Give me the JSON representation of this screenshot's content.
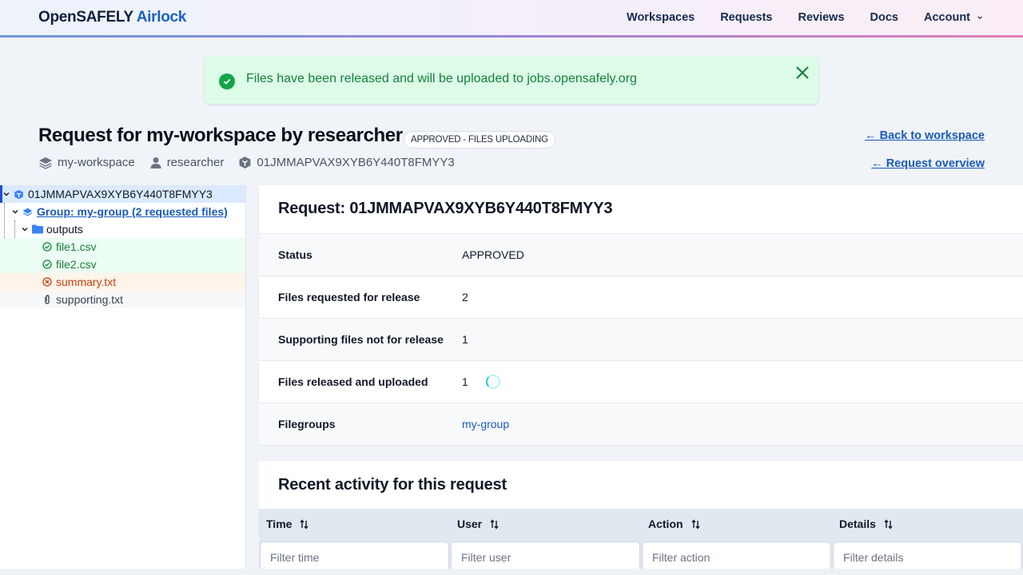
{
  "header": {
    "brand_main": "OpenSAFELY",
    "brand_accent": "Airlock",
    "nav": [
      {
        "label": "Workspaces"
      },
      {
        "label": "Requests"
      },
      {
        "label": "Reviews"
      },
      {
        "label": "Docs"
      },
      {
        "label": "Account",
        "icon": "chevron-down-icon"
      }
    ]
  },
  "flash": {
    "message": "Files have been released and will be uploaded to jobs.opensafely.org",
    "icon": "check-circle-icon",
    "close_icon": "close-icon",
    "color": "#15803d"
  },
  "page": {
    "title": "Request for my-workspace by researcher",
    "status_badge": "APPROVED - FILES UPLOADING",
    "meta": {
      "workspace": "my-workspace",
      "user": "researcher",
      "request_id": "01JMMAPVAX9XYB6Y440T8FMYY3"
    },
    "back_to_workspace": "← Back to workspace",
    "request_overview": "← Request overview"
  },
  "tree": {
    "root": {
      "label": "01JMMAPVAX9XYB6Y440T8FMYY3",
      "icon": "request-cube-icon"
    },
    "group": {
      "label": "Group: my-group (2 requested files)",
      "icon": "layers-icon"
    },
    "folder": {
      "label": "outputs",
      "icon": "folder-icon"
    },
    "files": [
      {
        "label": "file1.csv",
        "state": "approved",
        "icon": "check-circle-icon"
      },
      {
        "label": "file2.csv",
        "state": "approved",
        "icon": "check-circle-icon"
      },
      {
        "label": "summary.txt",
        "state": "rejected",
        "icon": "x-circle-icon"
      },
      {
        "label": "supporting.txt",
        "state": "supporting",
        "icon": "paperclip-icon"
      }
    ],
    "colors": {
      "approved": "#15803d",
      "rejected": "#c2410c",
      "supporting": "#374151",
      "link": "#1a5ab8"
    }
  },
  "request": {
    "title": "Request: 01JMMAPVAX9XYB6Y440T8FMYY3",
    "rows": [
      {
        "label": "Status",
        "value": "APPROVED"
      },
      {
        "label": "Files requested for release",
        "value": "2"
      },
      {
        "label": "Supporting files not for release",
        "value": "1"
      },
      {
        "label": "Files released and uploaded",
        "value": "1",
        "spinner": true
      },
      {
        "label": "Filegroups",
        "value": "my-group",
        "link": true
      }
    ]
  },
  "activity": {
    "title": "Recent activity for this request",
    "columns": [
      {
        "label": "Time",
        "filter_placeholder": "Filter time"
      },
      {
        "label": "User",
        "filter_placeholder": "Filter user"
      },
      {
        "label": "Action",
        "filter_placeholder": "Filter action"
      },
      {
        "label": "Details",
        "filter_placeholder": "Filter details"
      }
    ]
  }
}
